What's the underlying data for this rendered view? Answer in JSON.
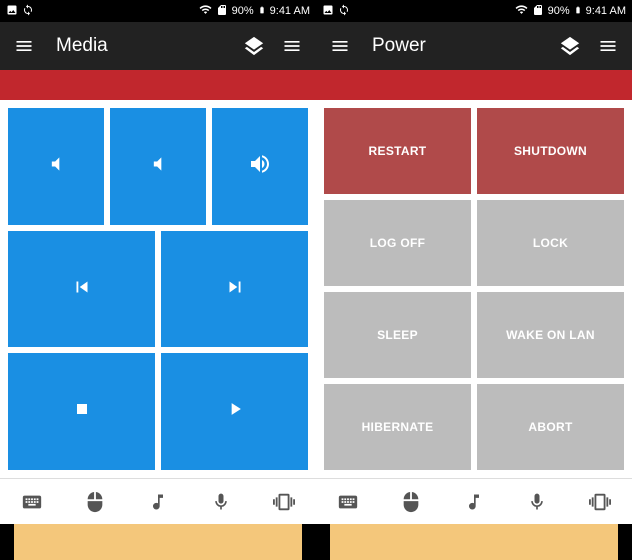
{
  "status": {
    "battery_pct": "90%",
    "time": "9:41 AM"
  },
  "left": {
    "title": "Media",
    "tiles": {
      "vol_down": "volume-down",
      "mute": "mute",
      "vol_up": "volume-up",
      "prev": "previous",
      "next": "next",
      "stop": "stop",
      "play": "play"
    }
  },
  "right": {
    "title": "Power",
    "tiles": {
      "restart": "RESTART",
      "shutdown": "SHUTDOWN",
      "logoff": "LOG OFF",
      "lock": "LOCK",
      "sleep": "SLEEP",
      "wol": "WAKE ON LAN",
      "hibernate": "HIBERNATE",
      "abort": "ABORT"
    }
  }
}
